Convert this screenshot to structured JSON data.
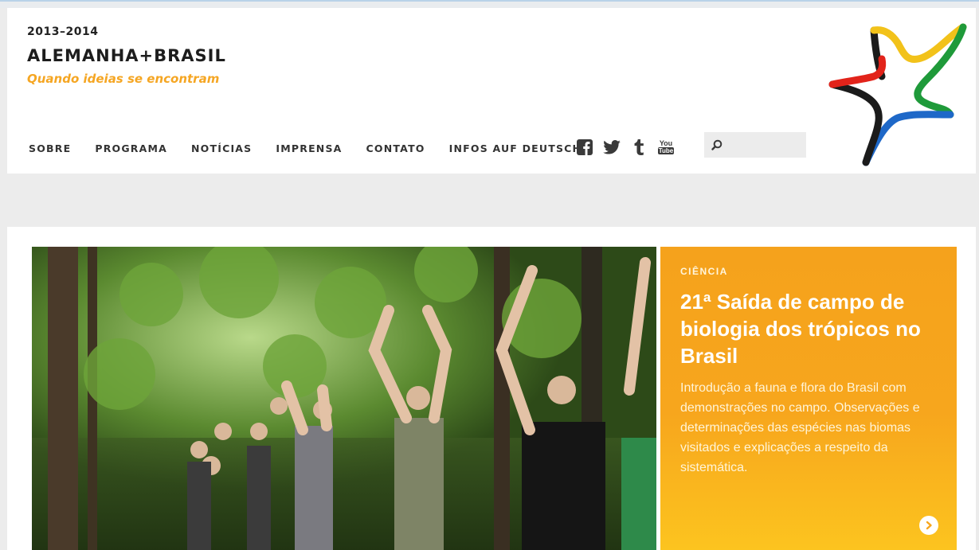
{
  "header": {
    "years": "2013–2014",
    "brand": "ALEMANHA+BRASIL",
    "tagline": "Quando ideias se encontram",
    "accent_color": "#f5a623"
  },
  "nav": {
    "items": [
      {
        "label": "SOBRE"
      },
      {
        "label": "PROGRAMA"
      },
      {
        "label": "NOTÍCIAS"
      },
      {
        "label": "IMPRENSA"
      },
      {
        "label": "CONTATO"
      },
      {
        "label": "INFOS AUF DEUTSCH"
      }
    ]
  },
  "social": {
    "icons": [
      "facebook-icon",
      "twitter-icon",
      "tumblr-icon",
      "youtube-icon"
    ],
    "youtube_top": "You",
    "youtube_bottom": "Tube"
  },
  "search": {
    "placeholder": "",
    "value": ""
  },
  "feature": {
    "category": "CIÊNCIA",
    "title": "21ª Saída de campo de biologia dos trópicos no Brasil",
    "description": "Introdução a fauna e flora do Brasil com demonstrações no campo. Observações e determinações das espécies nas biomas visitados e explicações a respeito da sistemática.",
    "card_color": "#f7a61d",
    "more_icon": "chevron-right-icon"
  },
  "hero": {
    "image_subject": "photo-icon"
  }
}
